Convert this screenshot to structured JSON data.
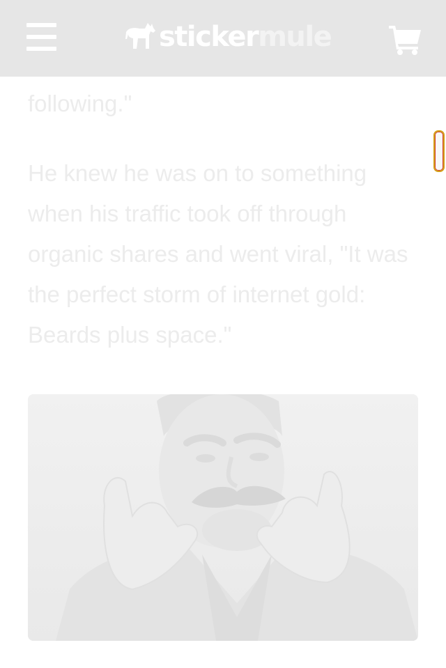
{
  "header": {
    "menu_icon": "hamburger-menu-icon",
    "logo": {
      "part1": "sticker",
      "part2": "mule",
      "icon": "mule-logo-icon"
    },
    "cart_icon": "shopping-cart-icon",
    "background": "#e6e6e6"
  },
  "article": {
    "paragraphs": [
      "Tuesday's \"Blogs you should be following.\"",
      "He knew he was on to something when his traffic took off through organic shares and went viral, \"It was the perfect storm of internet gold: Beards plus space.\""
    ],
    "image": {
      "subject": "man twirling mustache"
    }
  },
  "colors": {
    "text": "#ececec",
    "scroll_thumb_border": "#d4a017"
  }
}
